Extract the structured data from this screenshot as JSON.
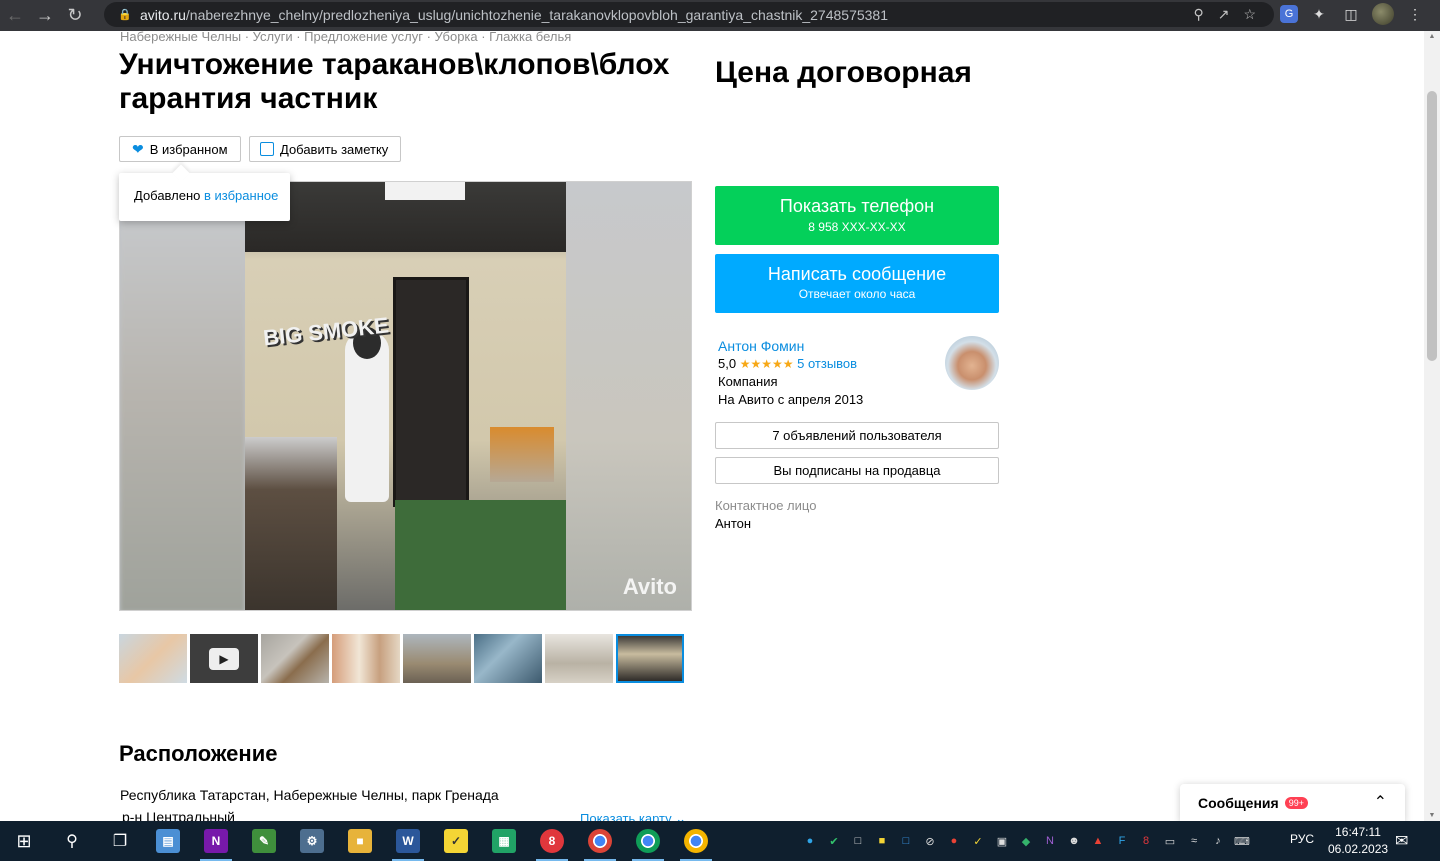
{
  "browser": {
    "url_host": "avito.ru",
    "url_path": "/naberezhnye_chelny/predlozheniya_uslug/unichtozhenie_tarakanovklopovbloh_garantiya_chastnik_2748575381"
  },
  "breadcrumb": "Набережные Челны · Услуги · Предложение услуг · Уборка · Глажка белья",
  "listing": {
    "title": "Уничтожение тараканов\\клопов\\блох гарантия частник",
    "price": "Цена договорная",
    "fav_label": "В избранном",
    "note_label": "Добавить заметку",
    "tooltip_prefix": "Добавлено",
    "tooltip_link": "в избранное",
    "watermark": "Avito",
    "graffiti": "BIG SMOKE"
  },
  "actions": {
    "phone_label": "Показать телефон",
    "phone_number": "8 958 XXX-XX-XX",
    "message_label": "Написать сообщение",
    "message_sub": "Отвечает около часа"
  },
  "seller": {
    "name": "Антон Фомин",
    "rating": "5,0",
    "stars": "★★★★★",
    "reviews": "5 отзывов",
    "type": "Компания",
    "since": "На Авито с апреля 2013",
    "listings_button": "7 объявлений пользователя",
    "subscribed_button": "Вы подписаны на продавца",
    "contact_label": "Контактное лицо",
    "contact_name": "Антон"
  },
  "location": {
    "title": "Расположение",
    "address": "Республика Татарстан, Набережные Челны, парк Гренада",
    "district": "р-н Центральный",
    "show_map": "Показать карту"
  },
  "messages_panel": {
    "label": "Сообщения",
    "badge": "99+"
  },
  "taskbar": {
    "lang": "РУС",
    "time": "16:47:11",
    "date": "06.02.2023"
  }
}
